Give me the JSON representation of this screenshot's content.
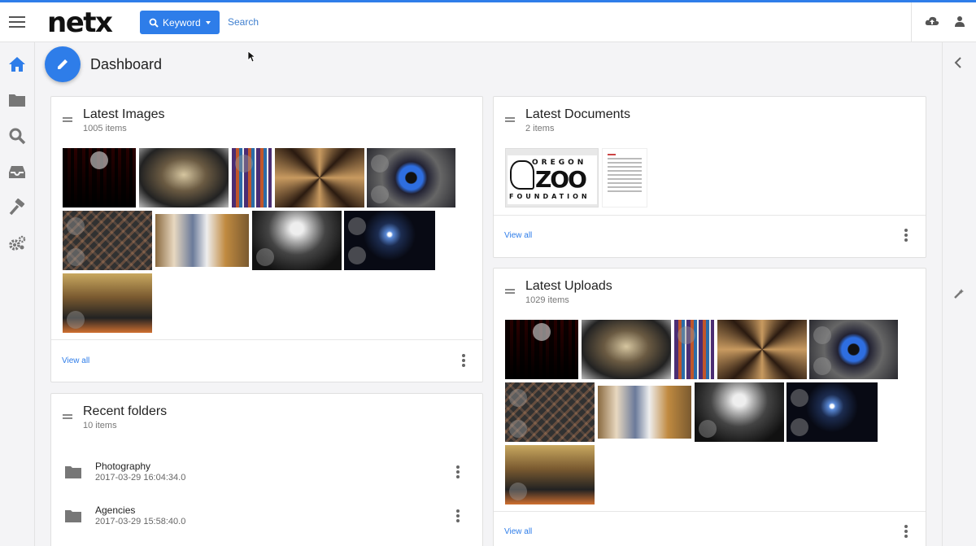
{
  "header": {
    "logo": "netx",
    "search_mode_label": "Keyword",
    "search_placeholder": "Search"
  },
  "page": {
    "title": "Dashboard"
  },
  "sidebar": {
    "items": [
      {
        "name": "home-icon",
        "active": true
      },
      {
        "name": "folder-icon"
      },
      {
        "name": "search-icon"
      },
      {
        "name": "inbox-icon"
      },
      {
        "name": "hammer-icon"
      },
      {
        "name": "settings-icon"
      }
    ]
  },
  "latest_images": {
    "title": "Latest Images",
    "count": "1005 items",
    "view_all": "View all"
  },
  "latest_documents": {
    "title": "Latest Documents",
    "count": "2 items",
    "view_all": "View all",
    "zoo_logo": {
      "top": "OREGON",
      "mid": "ZOO",
      "bottom": "FOUNDATION"
    }
  },
  "latest_uploads": {
    "title": "Latest Uploads",
    "count": "1029 items",
    "view_all": "View all"
  },
  "recent_folders": {
    "title": "Recent folders",
    "count": "10 items",
    "folders": [
      {
        "name": "Photography",
        "date": "2017-03-29 16:04:34.0"
      },
      {
        "name": "Agencies",
        "date": "2017-03-29 15:58:40.0"
      }
    ]
  },
  "colors": {
    "accent": "#2e7de9"
  }
}
